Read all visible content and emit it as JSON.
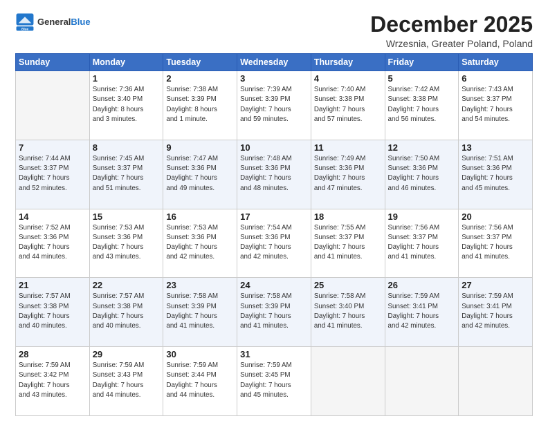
{
  "logo": {
    "line1": "General",
    "line2": "Blue"
  },
  "title": "December 2025",
  "subtitle": "Wrzesnia, Greater Poland, Poland",
  "weekdays": [
    "Sunday",
    "Monday",
    "Tuesday",
    "Wednesday",
    "Thursday",
    "Friday",
    "Saturday"
  ],
  "weeks": [
    [
      {
        "day": "",
        "info": ""
      },
      {
        "day": "1",
        "info": "Sunrise: 7:36 AM\nSunset: 3:40 PM\nDaylight: 8 hours\nand 3 minutes."
      },
      {
        "day": "2",
        "info": "Sunrise: 7:38 AM\nSunset: 3:39 PM\nDaylight: 8 hours\nand 1 minute."
      },
      {
        "day": "3",
        "info": "Sunrise: 7:39 AM\nSunset: 3:39 PM\nDaylight: 7 hours\nand 59 minutes."
      },
      {
        "day": "4",
        "info": "Sunrise: 7:40 AM\nSunset: 3:38 PM\nDaylight: 7 hours\nand 57 minutes."
      },
      {
        "day": "5",
        "info": "Sunrise: 7:42 AM\nSunset: 3:38 PM\nDaylight: 7 hours\nand 56 minutes."
      },
      {
        "day": "6",
        "info": "Sunrise: 7:43 AM\nSunset: 3:37 PM\nDaylight: 7 hours\nand 54 minutes."
      }
    ],
    [
      {
        "day": "7",
        "info": "Sunrise: 7:44 AM\nSunset: 3:37 PM\nDaylight: 7 hours\nand 52 minutes."
      },
      {
        "day": "8",
        "info": "Sunrise: 7:45 AM\nSunset: 3:37 PM\nDaylight: 7 hours\nand 51 minutes."
      },
      {
        "day": "9",
        "info": "Sunrise: 7:47 AM\nSunset: 3:36 PM\nDaylight: 7 hours\nand 49 minutes."
      },
      {
        "day": "10",
        "info": "Sunrise: 7:48 AM\nSunset: 3:36 PM\nDaylight: 7 hours\nand 48 minutes."
      },
      {
        "day": "11",
        "info": "Sunrise: 7:49 AM\nSunset: 3:36 PM\nDaylight: 7 hours\nand 47 minutes."
      },
      {
        "day": "12",
        "info": "Sunrise: 7:50 AM\nSunset: 3:36 PM\nDaylight: 7 hours\nand 46 minutes."
      },
      {
        "day": "13",
        "info": "Sunrise: 7:51 AM\nSunset: 3:36 PM\nDaylight: 7 hours\nand 45 minutes."
      }
    ],
    [
      {
        "day": "14",
        "info": "Sunrise: 7:52 AM\nSunset: 3:36 PM\nDaylight: 7 hours\nand 44 minutes."
      },
      {
        "day": "15",
        "info": "Sunrise: 7:53 AM\nSunset: 3:36 PM\nDaylight: 7 hours\nand 43 minutes."
      },
      {
        "day": "16",
        "info": "Sunrise: 7:53 AM\nSunset: 3:36 PM\nDaylight: 7 hours\nand 42 minutes."
      },
      {
        "day": "17",
        "info": "Sunrise: 7:54 AM\nSunset: 3:36 PM\nDaylight: 7 hours\nand 42 minutes."
      },
      {
        "day": "18",
        "info": "Sunrise: 7:55 AM\nSunset: 3:37 PM\nDaylight: 7 hours\nand 41 minutes."
      },
      {
        "day": "19",
        "info": "Sunrise: 7:56 AM\nSunset: 3:37 PM\nDaylight: 7 hours\nand 41 minutes."
      },
      {
        "day": "20",
        "info": "Sunrise: 7:56 AM\nSunset: 3:37 PM\nDaylight: 7 hours\nand 41 minutes."
      }
    ],
    [
      {
        "day": "21",
        "info": "Sunrise: 7:57 AM\nSunset: 3:38 PM\nDaylight: 7 hours\nand 40 minutes."
      },
      {
        "day": "22",
        "info": "Sunrise: 7:57 AM\nSunset: 3:38 PM\nDaylight: 7 hours\nand 40 minutes."
      },
      {
        "day": "23",
        "info": "Sunrise: 7:58 AM\nSunset: 3:39 PM\nDaylight: 7 hours\nand 41 minutes."
      },
      {
        "day": "24",
        "info": "Sunrise: 7:58 AM\nSunset: 3:39 PM\nDaylight: 7 hours\nand 41 minutes."
      },
      {
        "day": "25",
        "info": "Sunrise: 7:58 AM\nSunset: 3:40 PM\nDaylight: 7 hours\nand 41 minutes."
      },
      {
        "day": "26",
        "info": "Sunrise: 7:59 AM\nSunset: 3:41 PM\nDaylight: 7 hours\nand 42 minutes."
      },
      {
        "day": "27",
        "info": "Sunrise: 7:59 AM\nSunset: 3:41 PM\nDaylight: 7 hours\nand 42 minutes."
      }
    ],
    [
      {
        "day": "28",
        "info": "Sunrise: 7:59 AM\nSunset: 3:42 PM\nDaylight: 7 hours\nand 43 minutes."
      },
      {
        "day": "29",
        "info": "Sunrise: 7:59 AM\nSunset: 3:43 PM\nDaylight: 7 hours\nand 44 minutes."
      },
      {
        "day": "30",
        "info": "Sunrise: 7:59 AM\nSunset: 3:44 PM\nDaylight: 7 hours\nand 44 minutes."
      },
      {
        "day": "31",
        "info": "Sunrise: 7:59 AM\nSunset: 3:45 PM\nDaylight: 7 hours\nand 45 minutes."
      },
      {
        "day": "",
        "info": ""
      },
      {
        "day": "",
        "info": ""
      },
      {
        "day": "",
        "info": ""
      }
    ]
  ]
}
